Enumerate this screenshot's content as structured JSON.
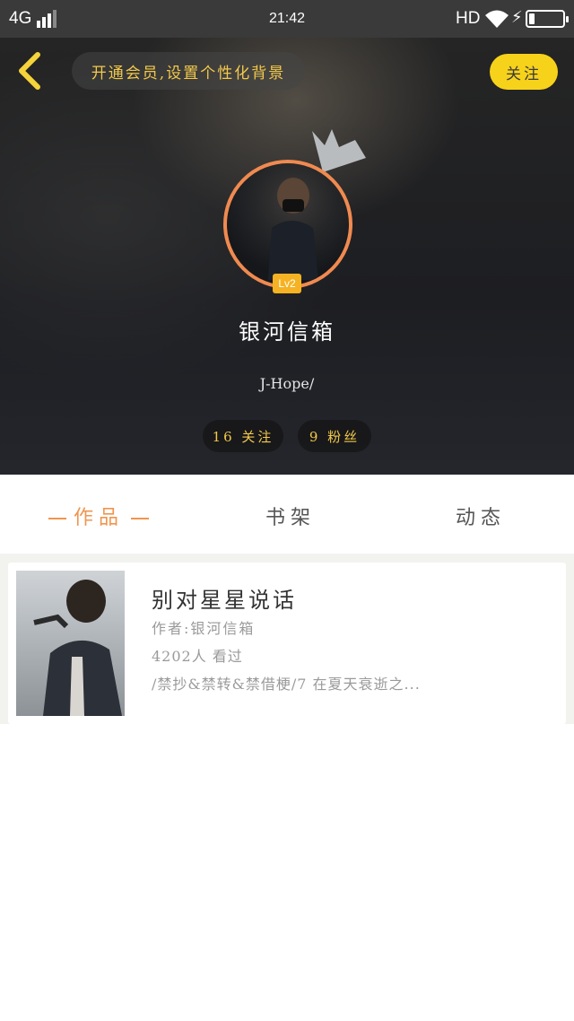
{
  "status_bar": {
    "network": "4G",
    "time": "21:42",
    "hd": "HD",
    "bolt": "⚡"
  },
  "header": {
    "vip_prompt": "开通会员,设置个性化背景",
    "follow_button": "关注"
  },
  "profile": {
    "level": "Lv2",
    "nickname": "银河信箱",
    "signature": "J-Hope/",
    "following": "16 关注",
    "fans": "9 粉丝"
  },
  "tabs": [
    {
      "label": "作品",
      "active": true
    },
    {
      "label": "书架",
      "active": false
    },
    {
      "label": "动态",
      "active": false
    }
  ],
  "works": [
    {
      "title": "别对星星说话",
      "author": "作者:银河信箱",
      "views": "4202人 看过",
      "description": "/禁抄&禁转&禁借梗/7 在夏天衰逝之..."
    }
  ],
  "colors": {
    "accent_orange": "#f0954e",
    "vip_gold": "#f3c94a",
    "follow_yellow": "#f7d21a",
    "level_badge": "#f5b223"
  }
}
